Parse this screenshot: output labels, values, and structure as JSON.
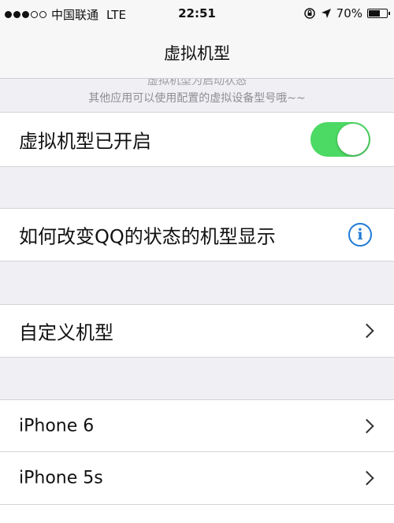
{
  "status_bar": {
    "carrier": "中国联通",
    "network": "LTE",
    "time": "22:51",
    "battery": "70%",
    "battery_level": 0.7
  },
  "nav": {
    "title": "虚拟机型"
  },
  "note": {
    "line1": "虚拟机型为启动状态",
    "line2": "其他应用可以使用配置的虚拟设备型号哦~~"
  },
  "cells": {
    "virtual_model_toggle": {
      "label": "虚拟机型已开启",
      "on": true
    },
    "how_to_change": {
      "label": "如何改变QQ的状态的机型显示"
    },
    "custom_model": {
      "label": "自定义机型"
    },
    "iphone6": {
      "label": "iPhone 6"
    },
    "iphone5s": {
      "label": "iPhone 5s"
    }
  },
  "colors": {
    "toggle_on": "#4cd964",
    "info_blue": "#1f7ad6",
    "group_bg": "#efeff4"
  },
  "icons": {
    "info": "i"
  }
}
